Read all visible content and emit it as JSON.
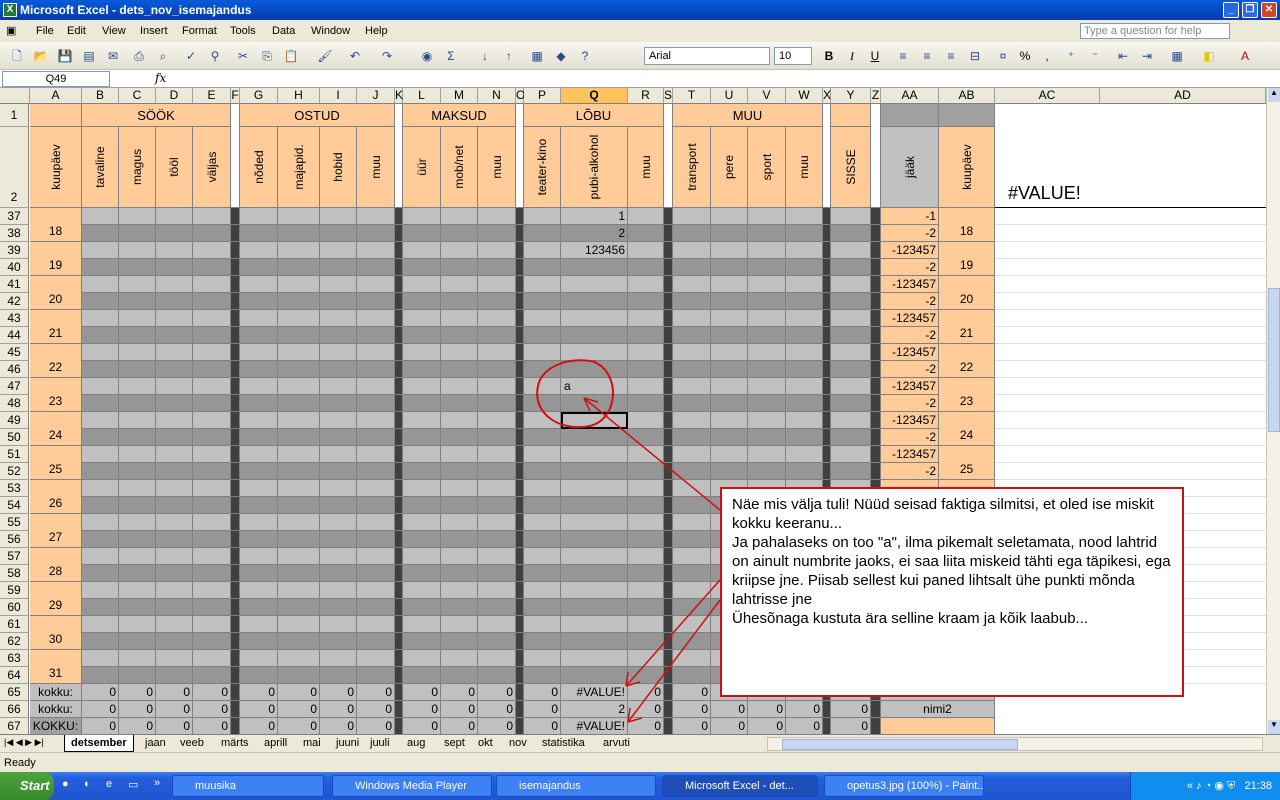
{
  "window": {
    "title": "Microsoft Excel - dets_nov_isemajandus"
  },
  "menu": [
    "File",
    "Edit",
    "View",
    "Insert",
    "Format",
    "Tools",
    "Data",
    "Window",
    "Help"
  ],
  "help_placeholder": "Type a question for help",
  "toolbar": {
    "font": "Arial",
    "size": "10",
    "bold": "B",
    "italic": "I",
    "underline": "U",
    "percent": "%",
    "comma": ","
  },
  "namebox": "Q49",
  "fx": "fx",
  "columns": [
    "A",
    "B",
    "C",
    "D",
    "E",
    "F",
    "G",
    "H",
    "I",
    "J",
    "K",
    "L",
    "M",
    "N",
    "O",
    "P",
    "Q",
    "R",
    "S",
    "T",
    "U",
    "V",
    "W",
    "X",
    "Y",
    "Z",
    "AA",
    "AB",
    "AC",
    "AD"
  ],
  "groups": {
    "sook": "SÖÖK",
    "ostud": "OSTUD",
    "maksud": "MAKSUD",
    "lobu": "LÕBU",
    "muu": "MUU"
  },
  "subheaders": {
    "A": "kuupäev",
    "B": "tavaline",
    "C": "magus",
    "D": "tööl",
    "E": "väljas",
    "G": "nõded",
    "H": "majapid.",
    "I": "hobid",
    "J": "muu",
    "L": "üür",
    "M": "mob/net",
    "N": "muu",
    "P": "teater-kino",
    "Q": "pubi-alkohol",
    "R": "muu",
    "T": "transport",
    "U": "pere",
    "V": "sport",
    "W": "muu",
    "Y": "SISSE",
    "AA": "jääk",
    "AB": "kuupäev"
  },
  "error_cell": "#VALUE!",
  "day_rows": [
    {
      "r1": "37",
      "r2": "38",
      "day": "18",
      "q1": "1",
      "q2": "2",
      "aa1": "-1",
      "aa2": "-2"
    },
    {
      "r1": "39",
      "r2": "40",
      "day": "19",
      "q1": "123456",
      "q2": "",
      "aa1": "-123457",
      "aa2": "-2"
    },
    {
      "r1": "41",
      "r2": "42",
      "day": "20",
      "q1": "",
      "q2": "",
      "aa1": "-123457",
      "aa2": "-2"
    },
    {
      "r1": "43",
      "r2": "44",
      "day": "21",
      "q1": "",
      "q2": "",
      "aa1": "-123457",
      "aa2": "-2"
    },
    {
      "r1": "45",
      "r2": "46",
      "day": "22",
      "q1": "",
      "q2": "",
      "aa1": "-123457",
      "aa2": "-2"
    },
    {
      "r1": "47",
      "r2": "48",
      "day": "23",
      "q1": "a",
      "q2": "",
      "aa1": "-123457",
      "aa2": "-2"
    },
    {
      "r1": "49",
      "r2": "50",
      "day": "24",
      "q1": "",
      "q2": "",
      "aa1": "-123457",
      "aa2": "-2"
    },
    {
      "r1": "51",
      "r2": "52",
      "day": "25",
      "q1": "",
      "q2": "",
      "aa1": "-123457",
      "aa2": "-2"
    },
    {
      "r1": "53",
      "r2": "54",
      "day": "26",
      "q1": "",
      "q2": "",
      "aa1": "",
      "aa2": ""
    },
    {
      "r1": "55",
      "r2": "56",
      "day": "27",
      "q1": "",
      "q2": "",
      "aa1": "",
      "aa2": ""
    },
    {
      "r1": "57",
      "r2": "58",
      "day": "28",
      "q1": "",
      "q2": "",
      "aa1": "",
      "aa2": ""
    },
    {
      "r1": "59",
      "r2": "60",
      "day": "29",
      "q1": "",
      "q2": "",
      "aa1": "",
      "aa2": ""
    },
    {
      "r1": "61",
      "r2": "62",
      "day": "30",
      "q1": "",
      "q2": "",
      "aa1": "",
      "aa2": ""
    },
    {
      "r1": "63",
      "r2": "64",
      "day": "31",
      "q1": "",
      "q2": "",
      "aa1": "",
      "aa2": ""
    }
  ],
  "total_rows": [
    {
      "row": "65",
      "label": "kokku:",
      "q": "#VALUE!",
      "nums": "0",
      "aa": "",
      "ab": ""
    },
    {
      "row": "66",
      "label": "kokku:",
      "q": "2",
      "nums": "0",
      "aa": "nimi2",
      "ab": ""
    },
    {
      "row": "67",
      "label": "KOKKU:",
      "q": "#VALUE!",
      "nums": "0",
      "aa": "",
      "ab": ""
    }
  ],
  "row_headers_top": {
    "r1": "1",
    "r2": "2"
  },
  "sheet_tabs": [
    "detsember",
    "jaan",
    "veeb",
    "märts",
    "aprill",
    "mai",
    "juuni",
    "juuli",
    "aug",
    "sept",
    "okt",
    "nov",
    "statistika",
    "arvuti"
  ],
  "status": "Ready",
  "taskbar": {
    "start": "Start",
    "items": [
      "muusika",
      "Windows Media Player",
      "isemajandus",
      "Microsoft Excel - det...",
      "opetus3.jpg (100%) - Paint..."
    ],
    "clock": "21:38"
  },
  "note": "Näe mis välja tuli! Nüüd seisad faktiga silmitsi, et oled ise miskit kokku keeranu...\nJa pahalaseks on too \"a\", ilma pikemalt seletamata, nood lahtrid on ainult numbrite jaoks, ei saa liita miskeid tähti ega täpikesi, ega kriipse jne. Piisab sellest kui paned lihtsalt ühe punkti mõnda lahtrisse jne\nÜhesõnaga kustuta ära selline kraam ja kõik laabub...",
  "colors": {
    "peach": "#ffcc99",
    "lgray": "#c0c0c0",
    "dgray": "#969696",
    "annotation": "#d01010"
  }
}
